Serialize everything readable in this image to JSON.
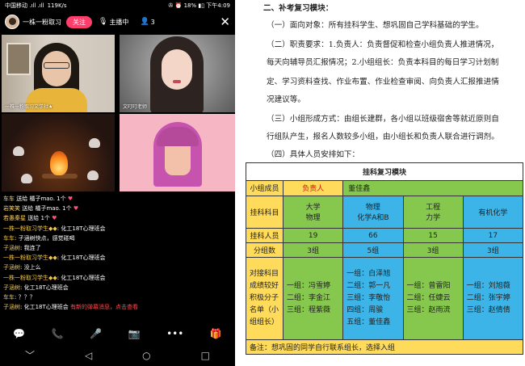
{
  "phone": {
    "status": {
      "carrier": "中国移动 .ıll .ıll",
      "speed": "119K/s",
      "right": "✇ ⏰ 18% ▮▯ 下午4:09"
    },
    "topbar": {
      "room_name": "一株一粉取习",
      "follow_label": "关注",
      "host_label": "主播中",
      "user_count": "3"
    },
    "tiles": [
      {
        "caption": "一株一粉取习文学社★"
      },
      {
        "caption": "文叮叮老师"
      },
      {
        "caption": ""
      },
      {
        "caption": ""
      }
    ],
    "chat": [
      {
        "name": "车车",
        "text": " 送给 橘子mao. 1个"
      },
      {
        "name": "岩笑笑",
        "text": " 送给 橘子mao. 1个"
      },
      {
        "name": "若愚秦星",
        "text": " 送给 1个"
      },
      {
        "name": "一株一粉取习学生◆◆",
        "text": ": 化工18T心理班会"
      },
      {
        "name": "车车",
        "text": ": 子涵树快点，感觉碰喝"
      },
      {
        "name": "子涵树",
        "text": ": 我连了"
      },
      {
        "name": "一株一粉取习学生◆◆",
        "text": ": 化工18T心理班会"
      },
      {
        "name": "子涵树",
        "text": ": 没上么"
      },
      {
        "name": "一株一粉取习学生◆◆",
        "text": ": 化工18T心理班会"
      },
      {
        "name": "子涵树",
        "text": ": 化工18T心理班会"
      },
      {
        "name": "车车",
        "text": ": ？？？"
      },
      {
        "name": "子涵树",
        "text": ": 化工18T心理班会"
      }
    ],
    "chat_hint": "有新的弹幕消息，点击查看",
    "toolbar": [
      "chat-icon",
      "phone-icon",
      "mic-icon",
      "camera-icon",
      "more-icon",
      "gift-icon"
    ],
    "nav": [
      "back",
      "home",
      "recent"
    ]
  },
  "doc": {
    "heading": "二、补考复习模块：",
    "paras": [
      "（一）面向对象：所有挂科学生、想巩固自己学科基础的学生。",
      "（二）职责要求：1.负责人：负责督促和检查小组负责人推进情况，",
      "每天向辅导员汇报情况；2.小组组长：负责本科目的每日学习计划制",
      "定、学习资料查找、作业布置、作业检查审阅、向负责人汇报推进情",
      "况建议等。",
      "（三）小组形成方式：由组长建群，各小组以班级宿舍等就近原则自",
      "行组队产生，报名人数较多小组，由小组长和负责人联合进行调剂。",
      "（四）具体人员安排如下："
    ],
    "table": {
      "title": "挂科复习模块",
      "row_member_label": "小组成员",
      "row_member_leader": "负责人",
      "row_member_name": "董佳鑫",
      "subject_label": "挂科科目",
      "subjects": [
        "大学\n物理",
        "物理\n化学A和B",
        "工程\n力学",
        "有机化学"
      ],
      "count_label": "挂科人员",
      "counts": [
        "19",
        "66",
        "15",
        "17"
      ],
      "group_label": "分组数",
      "groups": [
        "3组",
        "5组",
        "3组",
        "3组"
      ],
      "leaders_label": "对接科目成绩较好积极分子名单（小组组长）",
      "leaders": [
        [
          "一组：冯雪婷",
          "二组：李金江",
          "三组：程紫薇"
        ],
        [
          "一组：白泽旭",
          "二组：郭一凡",
          "三组：李敬怡",
          "四组：周骏",
          "五组：董佳鑫"
        ],
        [
          "一组：曾雷阳",
          "二组：任婕云",
          "三组：赵雨流"
        ],
        [
          "一组：刘旭薇",
          "二组：张宇婷",
          "三组：赵倩倩"
        ]
      ],
      "note": "备注：想巩固的同学自行联系组长，选择入组"
    }
  }
}
